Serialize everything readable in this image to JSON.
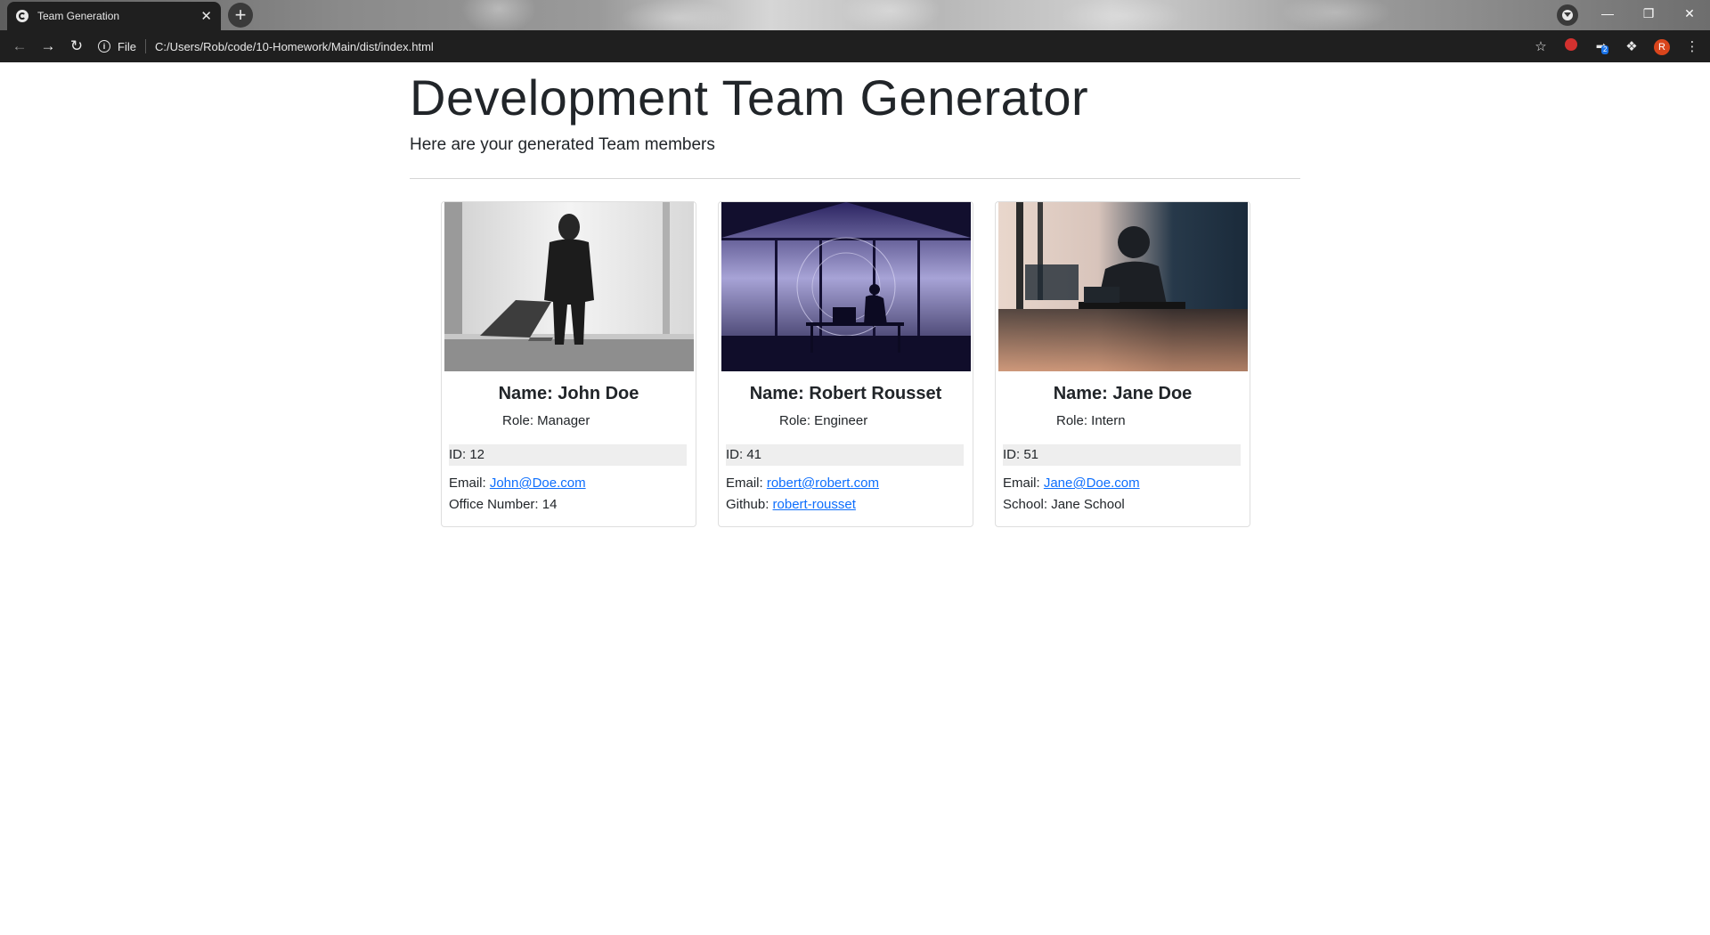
{
  "browser": {
    "tab_title": "Team Generation",
    "tab_close": "✕",
    "new_tab": "+",
    "site_label": "File",
    "url": "C:/Users/Rob/code/10-Homework/Main/dist/index.html",
    "extension_badge": "2",
    "profile_initial": "R"
  },
  "page": {
    "title": "Development Team Generator",
    "lead": "Here are your generated Team members"
  },
  "members": [
    {
      "name": "Name: John Doe",
      "role": "Role: Manager",
      "id": "ID: 12",
      "email_label": "Email: ",
      "email": "John@Doe.com",
      "extra_label": "Office Number: 14",
      "extra_link": ""
    },
    {
      "name": "Name: Robert Rousset",
      "role": "Role: Engineer",
      "id": "ID: 41",
      "email_label": "Email: ",
      "email": "robert@robert.com",
      "extra_label": "Github: ",
      "extra_link": "robert-rousset"
    },
    {
      "name": "Name: Jane Doe",
      "role": "Role: Intern",
      "id": "ID: 51",
      "email_label": "Email: ",
      "email": "Jane@Doe.com",
      "extra_label": "School: Jane School",
      "extra_link": ""
    }
  ],
  "colors": {
    "chrome_dark": "#1f1f1f",
    "link": "#0d6efd",
    "id_bg": "#eeeeee"
  }
}
